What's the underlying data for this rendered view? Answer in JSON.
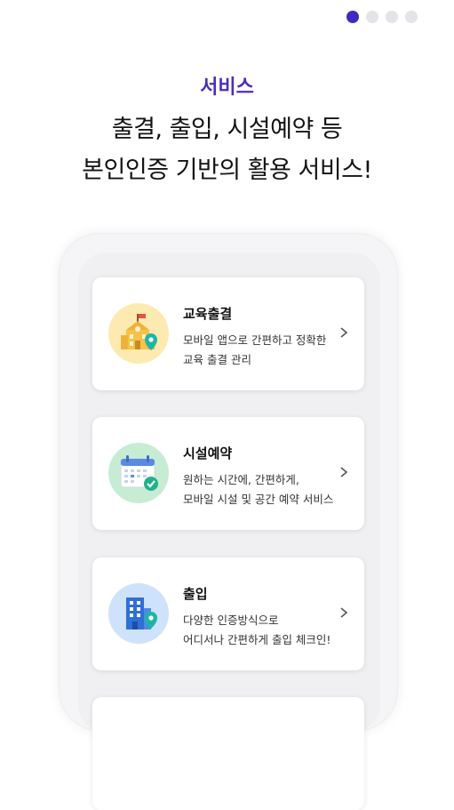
{
  "pagination": {
    "count": 4,
    "active": 0
  },
  "header": {
    "eyebrow": "서비스",
    "headline_line1": "출결, 출입, 시설예약 등",
    "headline_line2": "본인인증 기반의 활용 서비스!"
  },
  "services": [
    {
      "title": "교육출결",
      "desc_line1": "모바일 앱으로 간편하고 정확한",
      "desc_line2": "교육 출결 관리",
      "icon": "school-building-location-icon",
      "bg": "#fdeab0"
    },
    {
      "title": "시설예약",
      "desc_line1": "원하는 시간에, 간편하게,",
      "desc_line2": "모바일 시설 및 공간 예약 서비스",
      "icon": "calendar-check-icon",
      "bg": "#c6ecd4"
    },
    {
      "title": "출입",
      "desc_line1": "다양한 인증방식으로",
      "desc_line2": "어디서나 간편하게 출입 체크인!",
      "icon": "office-building-location-icon",
      "bg": "#cfe2fb"
    }
  ],
  "colors": {
    "accent": "#4a2fbf",
    "dot_active": "#3d2bc2",
    "dot_inactive": "#e3e3e8"
  }
}
